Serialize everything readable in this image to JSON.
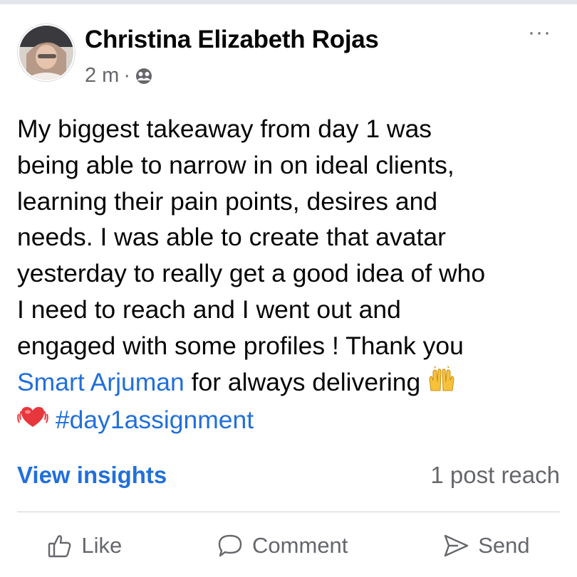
{
  "post": {
    "author": "Christina Elizabeth Rojas",
    "timestamp": "2 m",
    "meta_separator": "·",
    "audience_icon": "friends-icon",
    "more_label": "···",
    "body": {
      "line1": "My biggest takeaway from day 1 was",
      "line2": "being able to narrow in on ideal clients,",
      "line3": "learning their pain points, desires and",
      "line4": "needs. I was able to create that avatar",
      "line5": "yesterday to really get a good idea of who",
      "line6": "I need to reach and I went out and",
      "line7": "engaged with some profiles ! Thank you",
      "mention": "Smart Arjuman",
      "line8_rest": " for always delivering ",
      "hashtag": "#day1assignment"
    },
    "emojis": [
      "raising-hands",
      "beating-heart"
    ],
    "insights_label": "View insights",
    "reach_text": "1 post reach"
  },
  "actions": {
    "like": "Like",
    "comment": "Comment",
    "send": "Send"
  },
  "colors": {
    "link": "#216fdb",
    "secondary_text": "#65676b",
    "primary_text": "#050505",
    "divider": "#ced0d4"
  }
}
